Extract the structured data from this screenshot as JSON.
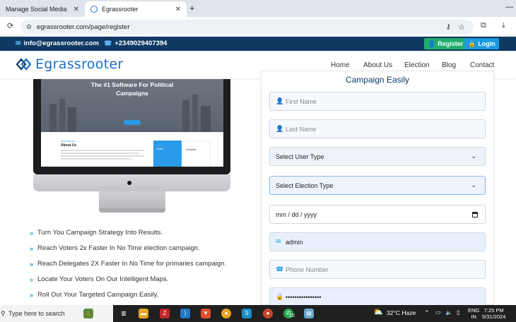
{
  "browser": {
    "tabs": [
      {
        "label": "Manage Social Media",
        "active": false
      },
      {
        "label": "Egrassrooter",
        "active": true
      }
    ],
    "new_tab_icon": "+",
    "url": "egrassrooter.com/page/register"
  },
  "topbar": {
    "email": "info@egrassrooter.com",
    "phone": "+2349029407394",
    "register_label": "Register",
    "login_label": "Login"
  },
  "navbar": {
    "logo_text": "Egrassrooter",
    "items": [
      "Home",
      "About Us",
      "Election",
      "Blog",
      "Contact"
    ]
  },
  "mockup": {
    "hero_title_line1": "The #1 Software For Political",
    "hero_title_line2": "Campaigns",
    "about_kicker": "WHO WE ARE",
    "about_heading": "About Us",
    "card1_title": "Vision",
    "card2_title": "Consular"
  },
  "features": [
    "Turn You Campaign Strategy Into Results.",
    "Reach Voters 2x Faster In No Time election campaign.",
    "Reach Delegates 2X Faster In No Time for primaries campaign.",
    "Locate Your Voters On Our Intelligent Maps.",
    "Roll Out Your Targeted Campaign Easily."
  ],
  "form": {
    "heading": "Campaign Easily",
    "first_name_placeholder": "First Name",
    "last_name_placeholder": "Last Name",
    "user_type_label": "Select User Type",
    "election_type_label": "Select Election Type",
    "date_placeholder": "mm / dd / yyyy",
    "username_value": "admin",
    "phone_placeholder": "Phone Number",
    "password_value": "••••••••••••••••"
  },
  "taskbar": {
    "search_placeholder": "Type here to search",
    "weather": "32°C  Haze",
    "lang_line1": "ENG",
    "lang_line2": "IN",
    "time": "7:25 PM",
    "date": "5/31/2024",
    "badge_count": "10"
  },
  "colors": {
    "topbar_bg": "#0f3a64",
    "register_bg": "#1fae6c",
    "login_bg": "#1a9ae0",
    "accent": "#1a9ae0"
  }
}
